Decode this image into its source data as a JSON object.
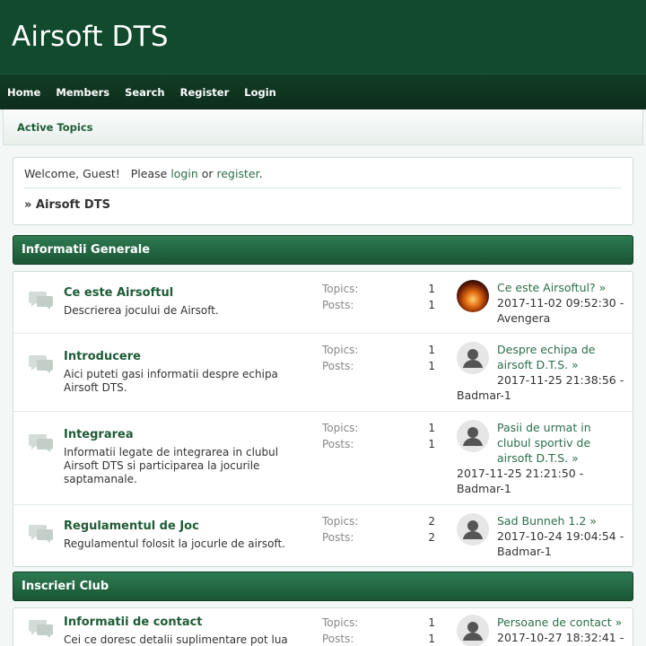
{
  "site": {
    "title": "Airsoft DTS"
  },
  "nav": [
    "Home",
    "Members",
    "Search",
    "Register",
    "Login"
  ],
  "subnav": {
    "active_topics": "Active Topics"
  },
  "welcome": {
    "prefix": "Welcome, Guest!   Please ",
    "login": "login",
    "middle": " or ",
    "register": "register",
    "suffix": ".",
    "breadcrumb": "» Airsoft DTS"
  },
  "labels": {
    "topics": "Topics:",
    "posts": "Posts:"
  },
  "categories": [
    {
      "title": "Informatii Generale",
      "boards": [
        {
          "name": "Ce este Airsoftul",
          "desc": "Descrierea jocului de Airsoft.",
          "topics": "1",
          "posts": "1",
          "last_title": "Ce este Airsoftul? »",
          "last_meta": "2017-11-02 09:52:30 - Avengera",
          "avatar": "flame"
        },
        {
          "name": "Introducere",
          "desc": "Aici puteti gasi informatii despre echipa Airsoft DTS.",
          "topics": "1",
          "posts": "1",
          "last_title": "Despre echipa de airsoft D.T.S. »",
          "last_meta": "2017-11-25 21:38:56 - Badmar-1",
          "avatar": "default"
        },
        {
          "name": "Integrarea",
          "desc": "Informatii legate de integrarea in clubul Airsoft DTS si participarea la jocurile saptamanale.",
          "topics": "1",
          "posts": "1",
          "last_title": "Pasii de urmat in clubul sportiv de airsoft D.T.S. »",
          "last_meta": "2017-11-25 21:21:50 - Badmar-1",
          "avatar": "default"
        },
        {
          "name": "Regulamentul de Joc",
          "desc": "Regulamentul folosit la jocurle de airsoft.",
          "topics": "2",
          "posts": "2",
          "last_title": "Sad Bunneh 1.2 »",
          "last_meta": "2017-10-24 19:04:54 - Badmar-1",
          "avatar": "default"
        }
      ]
    },
    {
      "title": "Inscrieri Club",
      "boards": [
        {
          "name": "Informatii de contact",
          "desc": "Cei ce doresc detalii suplimentare pot lua",
          "topics": "1",
          "posts": "1",
          "last_title": "Persoane de contact »",
          "last_meta": "2017-10-27 18:32:41 -",
          "avatar": "default"
        }
      ]
    }
  ]
}
